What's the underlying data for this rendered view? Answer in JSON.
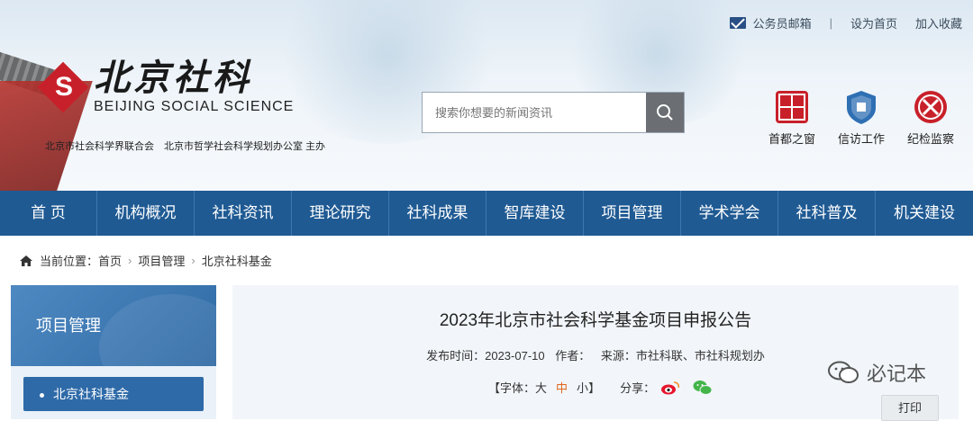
{
  "top_links": {
    "mail": "公务员邮箱",
    "homepage": "设为首页",
    "favorite": "加入收藏",
    "divider": "|"
  },
  "logo": {
    "cn": "北京社科",
    "en": "BEIJING SOCIAL SCIENCE",
    "mark": "S"
  },
  "sponsor": "北京市社会科学界联合会　北京市哲学社会科学规划办公室 主办",
  "search": {
    "placeholder": "搜索你想要的新闻资讯"
  },
  "quick_links": [
    {
      "label": "首都之窗",
      "icon": "capital-window-icon"
    },
    {
      "label": "信访工作",
      "icon": "petition-shield-icon"
    },
    {
      "label": "纪检监察",
      "icon": "discipline-seal-icon"
    }
  ],
  "nav": [
    "首 页",
    "机构概况",
    "社科资讯",
    "理论研究",
    "社科成果",
    "智库建设",
    "项目管理",
    "学术学会",
    "社科普及",
    "机关建设"
  ],
  "breadcrumb": {
    "prefix": "当前位置：",
    "items": [
      "首页",
      "项目管理",
      "北京社科基金"
    ]
  },
  "sidebar": {
    "title": "项目管理",
    "active_item": "北京社科基金"
  },
  "article": {
    "title": "2023年北京市社会科学基金项目申报公告",
    "publish_label": "发布时间：2023-07-10",
    "author_label": "作者：",
    "source_label": "来源：市社科联、市社科规划办",
    "font_prefix": "【字体：",
    "font_large": "大",
    "font_mid": "中",
    "font_small": "小",
    "font_suffix": "】",
    "share_label": "分享：",
    "print_label": "打印"
  },
  "watermark": "必记本",
  "colors": {
    "nav": "#1f5a93",
    "side_active": "#2e6aa8",
    "logo_red": "#c8202a",
    "mid_accent": "#e0661c"
  }
}
